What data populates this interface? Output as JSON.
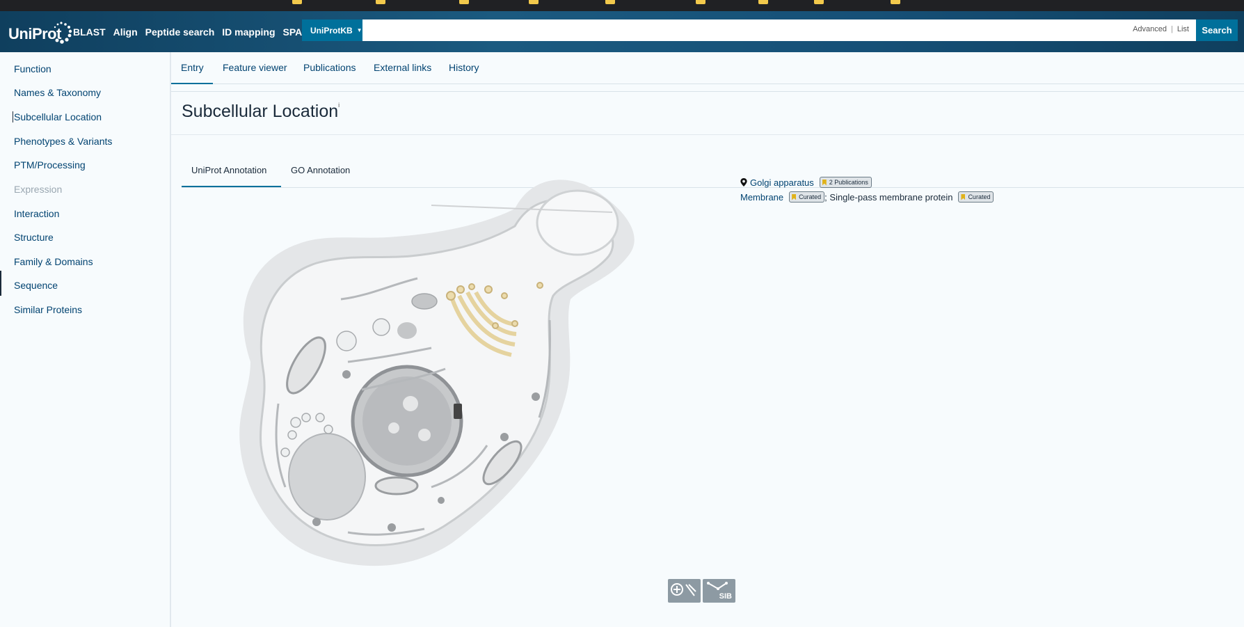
{
  "header": {
    "brand": "UniProt",
    "nav": [
      "BLAST",
      "Align",
      "Peptide search",
      "ID mapping",
      "SPARQL"
    ],
    "database_select": "UniProtKB",
    "search_placeholder": "",
    "advanced_label": "Advanced",
    "list_label": "List",
    "search_button": "Search"
  },
  "sidebar": {
    "items": [
      {
        "label": "Function",
        "enabled": true
      },
      {
        "label": "Names & Taxonomy",
        "enabled": true
      },
      {
        "label": "Subcellular Location",
        "enabled": true
      },
      {
        "label": "Phenotypes & Variants",
        "enabled": true
      },
      {
        "label": "PTM/Processing",
        "enabled": true
      },
      {
        "label": "Expression",
        "enabled": false
      },
      {
        "label": "Interaction",
        "enabled": true
      },
      {
        "label": "Structure",
        "enabled": true
      },
      {
        "label": "Family & Domains",
        "enabled": true
      },
      {
        "label": "Sequence",
        "enabled": true
      },
      {
        "label": "Similar Proteins",
        "enabled": true
      }
    ]
  },
  "entry_tabs": [
    "Entry",
    "Feature viewer",
    "Publications",
    "External links",
    "History"
  ],
  "section": {
    "title": "Subcellular Location",
    "info_marker": "i"
  },
  "annotation_tabs": [
    "UniProt Annotation",
    "GO Annotation"
  ],
  "locations": [
    {
      "name": "Golgi apparatus",
      "badge": "2 Publications"
    },
    {
      "name": "Membrane",
      "badge": "Curated",
      "topology": "; Single-pass membrane protein",
      "topology_badge": "Curated"
    }
  ],
  "footer_logos": [
    "swissbiopics-logo",
    "SIB"
  ],
  "colors": {
    "header_bg": "#0f3f5e",
    "accent": "#00709b",
    "link": "#014371",
    "golgi": "#e8d9a8"
  }
}
